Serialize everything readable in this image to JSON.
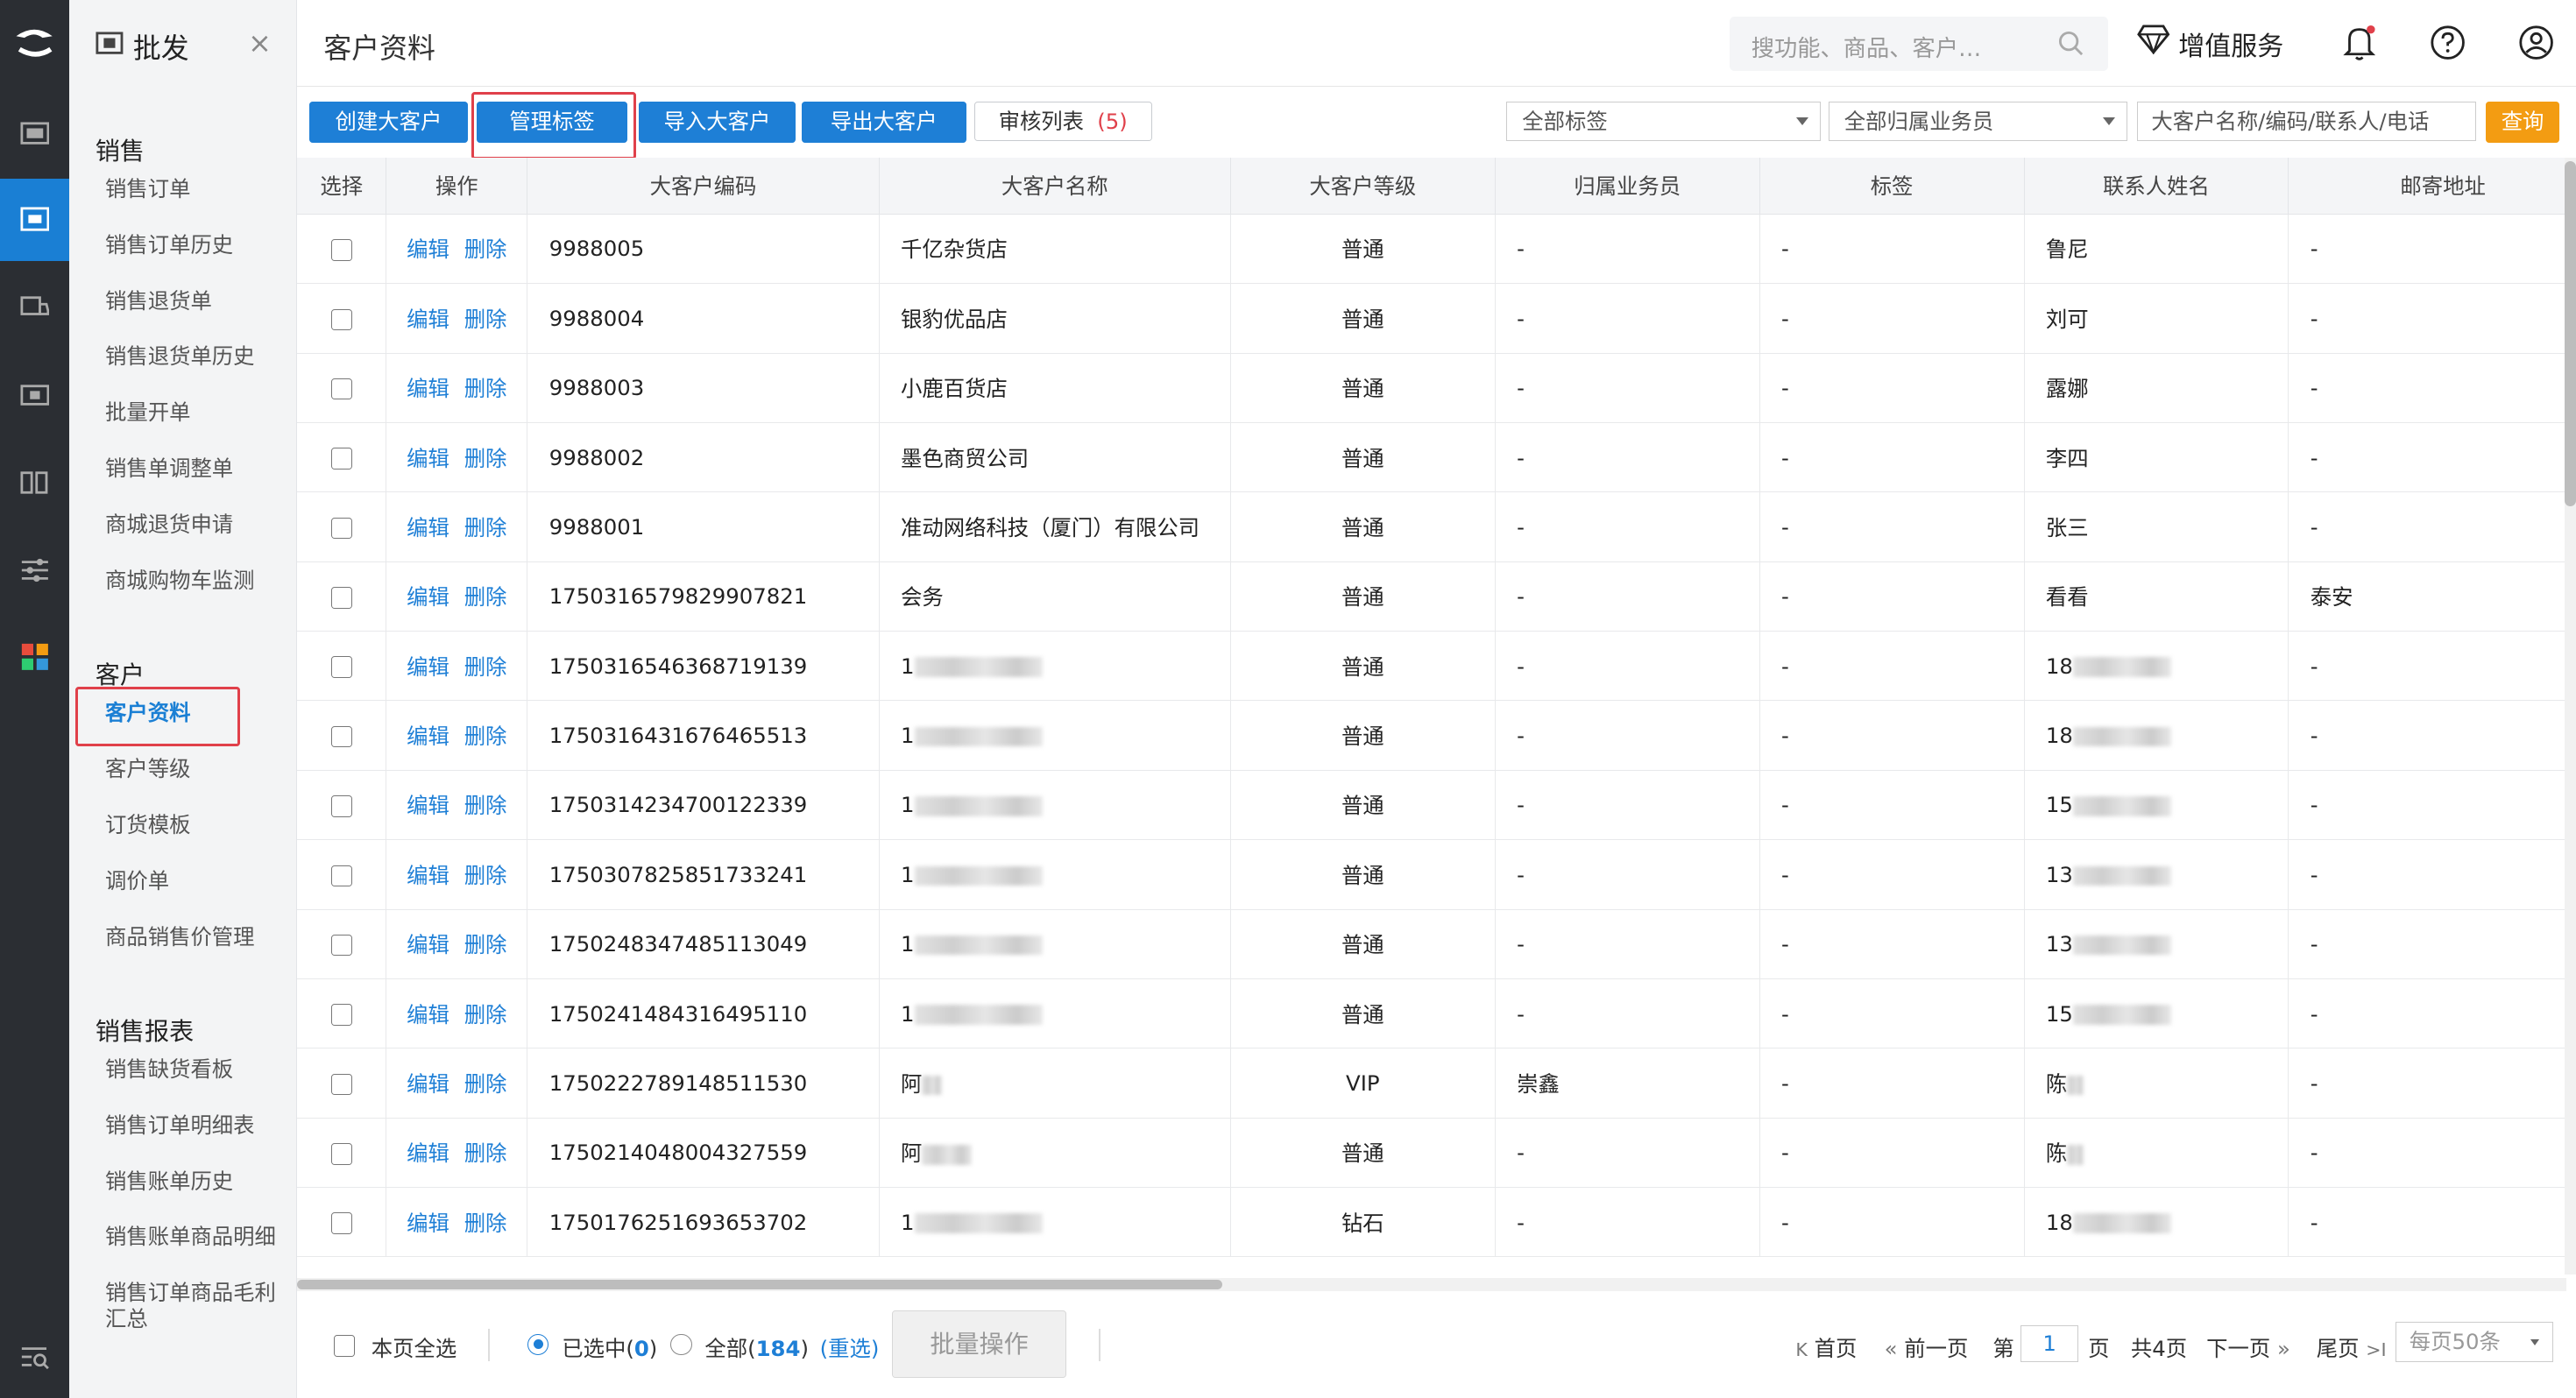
{
  "app": {
    "module_title": "批发",
    "close_glyph": "×"
  },
  "sidebar": {
    "sections": [
      {
        "title": "销售",
        "items": [
          "销售订单",
          "销售订单历史",
          "销售退货单",
          "销售退货单历史",
          "批量开单",
          "销售单调整单",
          "商城退货申请",
          "商城购物车监测"
        ]
      },
      {
        "title": "客户",
        "items": [
          "客户资料",
          "客户等级",
          "订货模板",
          "调价单",
          "商品销售价管理"
        ]
      },
      {
        "title": "销售报表",
        "items": [
          "销售缺货看板",
          "销售订单明细表",
          "销售账单历史",
          "销售账单商品明细",
          "销售订单商品毛利汇总"
        ]
      }
    ],
    "active_item": "客户资料"
  },
  "header": {
    "page_title": "客户资料",
    "search_placeholder": "搜功能、商品、客户…",
    "value_added": "增值服务",
    "notification_dot": true
  },
  "toolbar": {
    "create": "创建大客户",
    "manage_tags": "管理标签",
    "import": "导入大客户",
    "export": "导出大客户",
    "review_list": "审核列表",
    "review_count": "(5)",
    "filter_tags": "全部标签",
    "filter_sales": "全部归属业务员",
    "keyword_placeholder": "大客户名称/编码/联系人/电话",
    "query": "查询"
  },
  "table": {
    "columns": [
      "选择",
      "操作",
      "大客户编码",
      "大客户名称",
      "大客户等级",
      "归属业务员",
      "标签",
      "联系人姓名",
      "邮寄地址"
    ],
    "edit_label": "编辑",
    "delete_label": "删除",
    "rows": [
      {
        "code": "9988005",
        "name": "千亿杂货店",
        "level": "普通",
        "sales": "-",
        "tag": "-",
        "contact": "鲁尼",
        "address": "-"
      },
      {
        "code": "9988004",
        "name": "银豹优品店",
        "level": "普通",
        "sales": "-",
        "tag": "-",
        "contact": "刘可",
        "address": "-"
      },
      {
        "code": "9988003",
        "name": "小鹿百货店",
        "level": "普通",
        "sales": "-",
        "tag": "-",
        "contact": "露娜",
        "address": "-"
      },
      {
        "code": "9988002",
        "name": "墨色商贸公司",
        "level": "普通",
        "sales": "-",
        "tag": "-",
        "contact": "李四",
        "address": "-"
      },
      {
        "code": "9988001",
        "name": "准动网络科技（厦门）有限公司",
        "level": "普通",
        "sales": "-",
        "tag": "-",
        "contact": "张三",
        "address": "-"
      },
      {
        "code": "1750316579829907821",
        "name": "会务",
        "level": "普通",
        "sales": "-",
        "tag": "-",
        "contact": "看看",
        "address": "泰安"
      },
      {
        "code": "1750316546368719139",
        "name": "1",
        "name_blur": 78,
        "level": "普通",
        "sales": "-",
        "tag": "-",
        "contact": "18",
        "contact_blur": 60,
        "address": "-"
      },
      {
        "code": "1750316431676465513",
        "name": "1",
        "name_blur": 78,
        "level": "普通",
        "sales": "-",
        "tag": "-",
        "contact": "18",
        "contact_blur": 60,
        "address": "-"
      },
      {
        "code": "1750314234700122339",
        "name": "1",
        "name_blur": 78,
        "level": "普通",
        "sales": "-",
        "tag": "-",
        "contact": "15",
        "contact_blur": 60,
        "address": "-"
      },
      {
        "code": "1750307825851733241",
        "name": "1",
        "name_blur": 78,
        "level": "普通",
        "sales": "-",
        "tag": "-",
        "contact": "13",
        "contact_blur": 60,
        "address": "-"
      },
      {
        "code": "1750248347485113049",
        "name": "1",
        "name_blur": 78,
        "level": "普通",
        "sales": "-",
        "tag": "-",
        "contact": "13",
        "contact_blur": 60,
        "address": "-"
      },
      {
        "code": "1750241484316495110",
        "name": "1",
        "name_blur": 78,
        "level": "普通",
        "sales": "-",
        "tag": "-",
        "contact": "15",
        "contact_blur": 60,
        "address": "-"
      },
      {
        "code": "1750222789148511530",
        "name": "阿",
        "name_blur": 12,
        "level": "VIP",
        "sales": "崇鑫",
        "tag": "-",
        "contact": "陈",
        "contact_blur": 10,
        "address": "-"
      },
      {
        "code": "1750214048004327559",
        "name": "阿",
        "name_blur": 30,
        "level": "普通",
        "sales": "-",
        "tag": "-",
        "contact": "陈",
        "contact_blur": 10,
        "address": "-"
      },
      {
        "code": "1750176251693653702",
        "name": "1",
        "name_blur": 78,
        "level": "钻石",
        "sales": "-",
        "tag": "-",
        "contact": "18",
        "contact_blur": 60,
        "address": "-"
      }
    ]
  },
  "footer": {
    "select_page": "本页全选",
    "selected_label": "已选中(",
    "selected_count": "0",
    "selected_close": ")",
    "all_label": "全部(",
    "all_count": "184",
    "all_close": ")",
    "reselect": "(重选)",
    "batch": "批量操作",
    "first": "首页",
    "prev": "前一页",
    "page_prefix": "第",
    "page_value": "1",
    "page_suffix": "页",
    "total_pages": "共4页",
    "next": "下一页",
    "last": "尾页",
    "per_page": "每页50条"
  },
  "colors": {
    "primary": "#1e7fd6",
    "highlight": "#e0404a",
    "query": "#f39c12",
    "dark_nav": "#2b2e33"
  }
}
